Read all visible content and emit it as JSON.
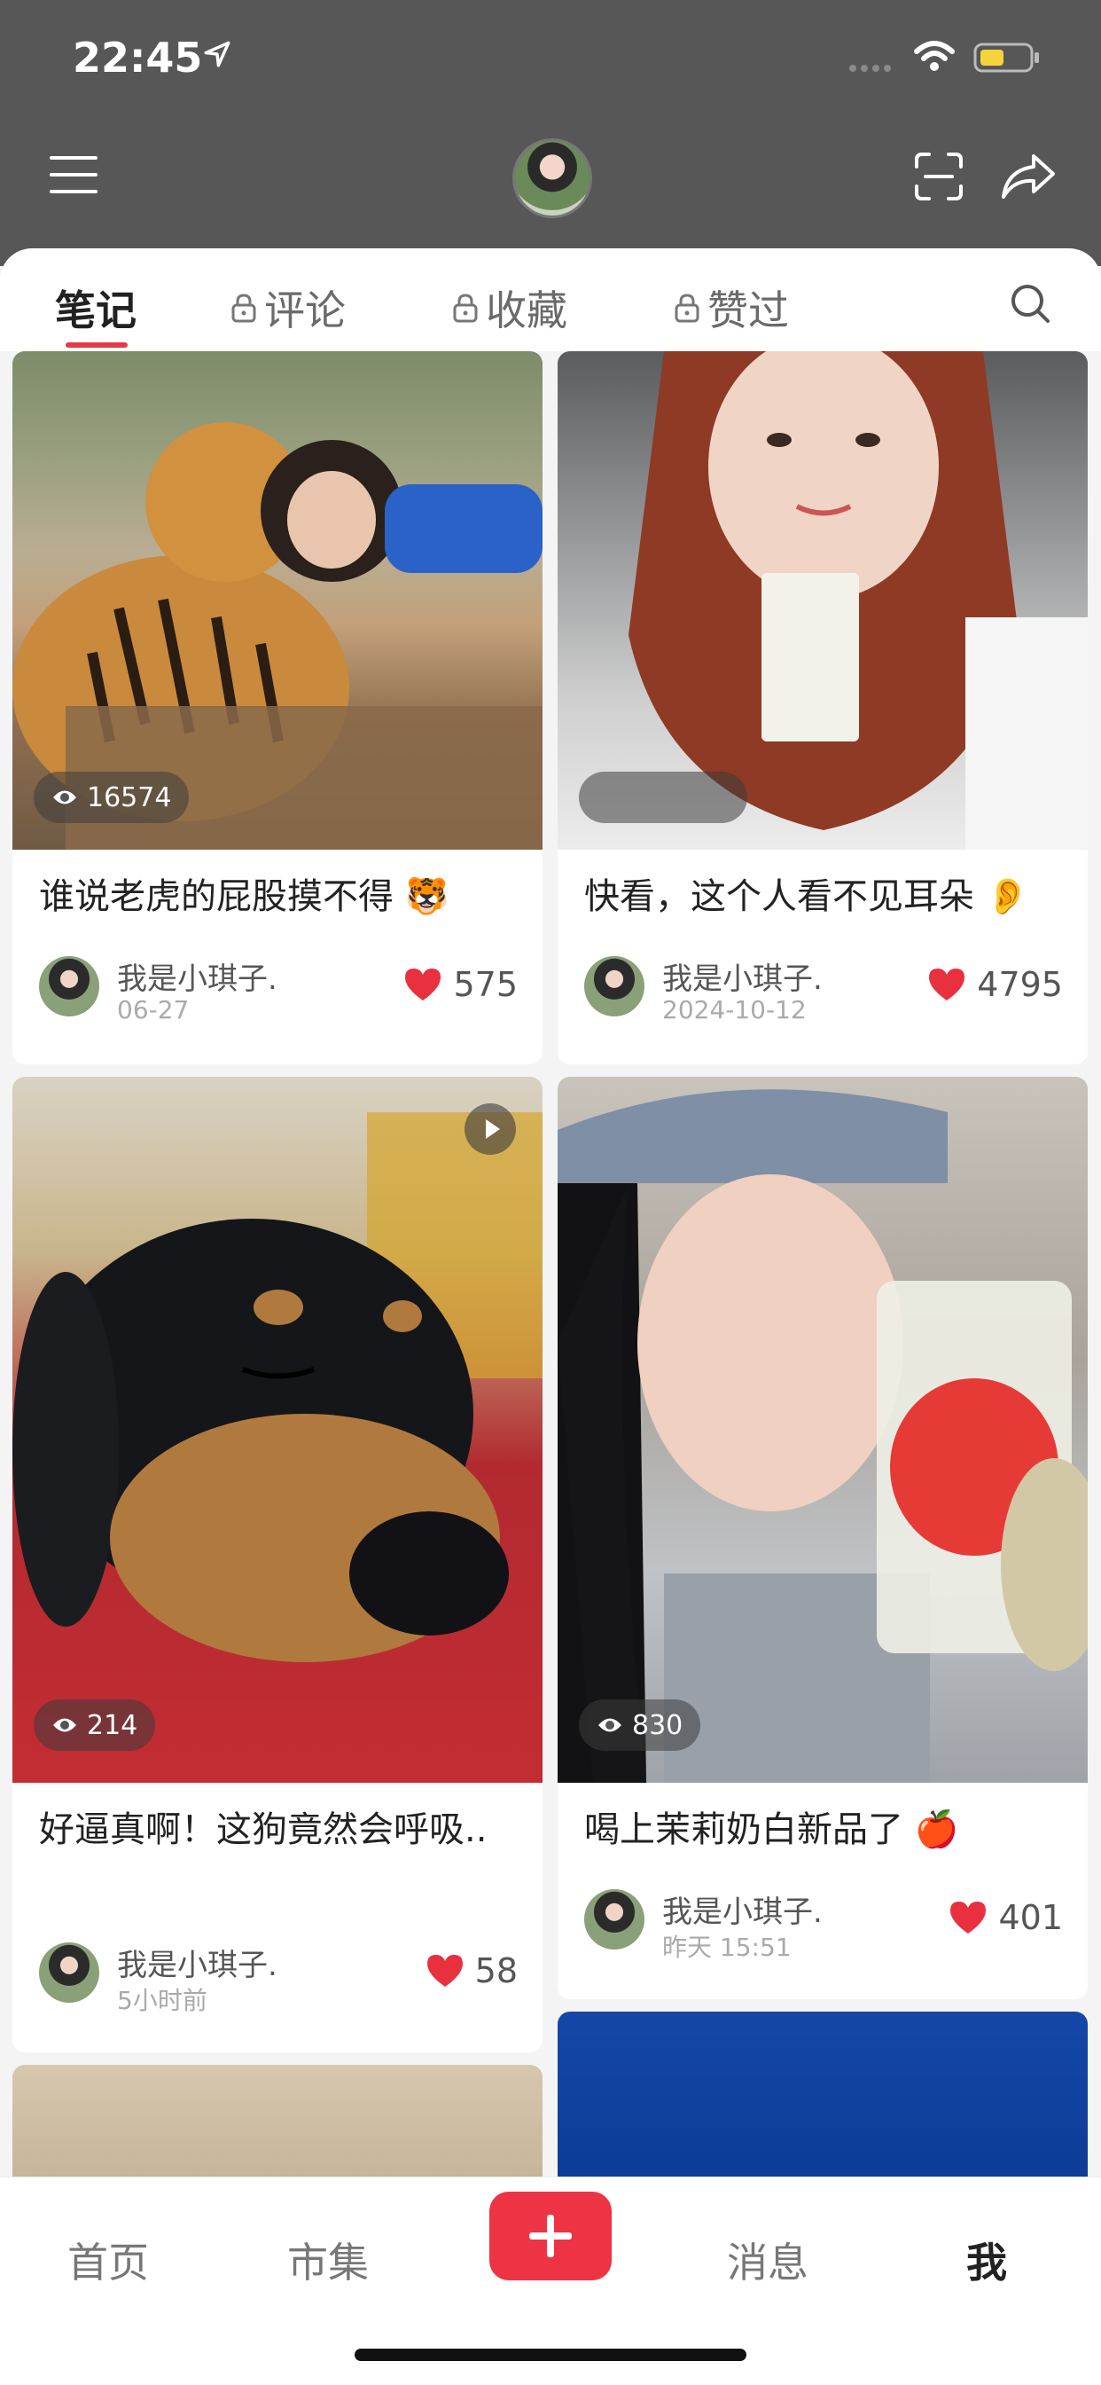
{
  "status_bar": {
    "time": "22:45"
  },
  "tabs": [
    {
      "label": "笔记",
      "locked": false
    },
    {
      "label": "评论",
      "locked": true
    },
    {
      "label": "收藏",
      "locked": true
    },
    {
      "label": "赞过",
      "locked": true
    }
  ],
  "notes": [
    {
      "title": "谁说老虎的屁股摸不得 🐯",
      "author": "我是小琪子.",
      "date": "06-27",
      "likes": "575",
      "views": "16574"
    },
    {
      "title": "快看，这个人看不见耳朵 👂",
      "author": "我是小琪子.",
      "date": "2024-10-12",
      "likes": "4795",
      "views": ""
    },
    {
      "title": "好逼真啊！这狗竟然会呼吸..",
      "author": "我是小琪子.",
      "date": "5小时前",
      "likes": "58",
      "views": "214"
    },
    {
      "title": "喝上茉莉奶白新品了 🍎",
      "author": "我是小琪子.",
      "date": "昨天 15:51",
      "likes": "401",
      "views": "830"
    }
  ],
  "bottom_nav": {
    "home": "首页",
    "market": "市集",
    "messages": "消息",
    "me": "我"
  },
  "colors": {
    "accent": "#e23a4b",
    "topbar": "#575757",
    "heart": "#e8303f"
  }
}
